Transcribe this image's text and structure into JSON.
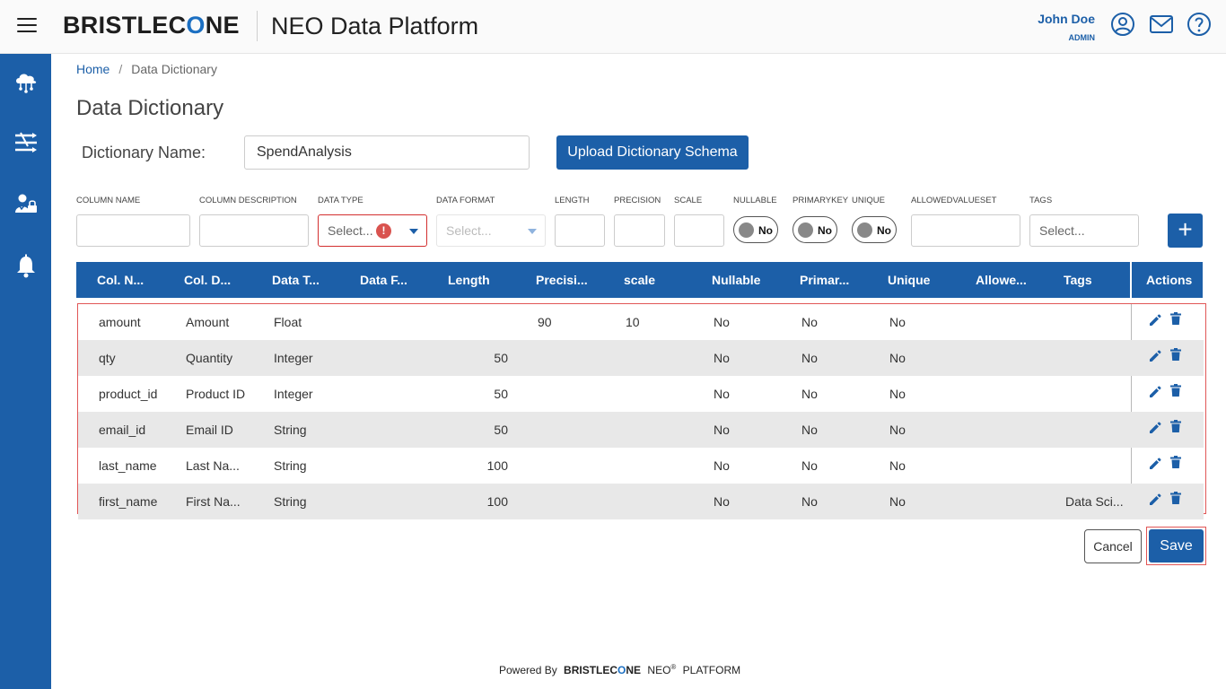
{
  "header": {
    "brand_left": "BRISTLEC",
    "brand_o": "O",
    "brand_right": "NE",
    "app_title": "NEO Data Platform",
    "user_name": "John Doe",
    "user_role": "ADMIN"
  },
  "breadcrumb": {
    "home": "Home",
    "sep": "/",
    "current": "Data Dictionary"
  },
  "page_title": "Data Dictionary",
  "dictionary": {
    "label": "Dictionary Name:",
    "value": "SpendAnalysis",
    "upload_label": "Upload Dictionary Schema"
  },
  "form": {
    "labels": {
      "column_name": "COLUMN NAME",
      "column_description": "COLUMN DESCRIPTION",
      "data_type": "DATA TYPE",
      "data_format": "DATA FORMAT",
      "length": "LENGTH",
      "precision": "PRECISION",
      "scale": "SCALE",
      "nullable": "NULLABLE",
      "primarykey": "PRIMARYKEY",
      "unique": "UNIQUE",
      "allowedvalueset": "ALLOWEDVALUESET",
      "tags": "TAGS"
    },
    "data_type_placeholder": "Select...",
    "data_type_error": "!",
    "data_format_placeholder": "Select...",
    "tags_placeholder": "Select...",
    "nullable_value": "No",
    "primarykey_value": "No",
    "unique_value": "No",
    "add_label": "+"
  },
  "table": {
    "headers": [
      "Col. N...",
      "Col. D...",
      "Data T...",
      "Data F...",
      "Length",
      "Precisi...",
      "scale",
      "Nullable",
      "Primar...",
      "Unique",
      "Allowe...",
      "Tags",
      "Actions"
    ],
    "rows": [
      {
        "name": "amount",
        "desc": "Amount",
        "type": "Float",
        "format": "",
        "length": "",
        "precision": "90",
        "scale": "10",
        "nullable": "No",
        "primary": "No",
        "unique": "No",
        "allowed": "",
        "tags": ""
      },
      {
        "name": "qty",
        "desc": "Quantity",
        "type": "Integer",
        "format": "",
        "length": "50",
        "precision": "",
        "scale": "",
        "nullable": "No",
        "primary": "No",
        "unique": "No",
        "allowed": "",
        "tags": ""
      },
      {
        "name": "product_id",
        "desc": "Product ID",
        "type": "Integer",
        "format": "",
        "length": "50",
        "precision": "",
        "scale": "",
        "nullable": "No",
        "primary": "No",
        "unique": "No",
        "allowed": "",
        "tags": ""
      },
      {
        "name": "email_id",
        "desc": "Email ID",
        "type": "String",
        "format": "",
        "length": "50",
        "precision": "",
        "scale": "",
        "nullable": "No",
        "primary": "No",
        "unique": "No",
        "allowed": "",
        "tags": ""
      },
      {
        "name": "last_name",
        "desc": "Last Na...",
        "type": "String",
        "format": "",
        "length": "100",
        "precision": "",
        "scale": "",
        "nullable": "No",
        "primary": "No",
        "unique": "No",
        "allowed": "",
        "tags": ""
      },
      {
        "name": "first_name",
        "desc": "First Na...",
        "type": "String",
        "format": "",
        "length": "100",
        "precision": "",
        "scale": "",
        "nullable": "No",
        "primary": "No",
        "unique": "No",
        "allowed": "",
        "tags": "Data Sci..."
      }
    ]
  },
  "buttons": {
    "cancel": "Cancel",
    "save": "Save"
  },
  "footer": {
    "powered_by": "Powered By",
    "brand_left": "BRISTLEC",
    "brand_o": "O",
    "brand_right": "NE",
    "neo": "NEO",
    "reg": "®",
    "platform": "PLATFORM"
  },
  "colors": {
    "primary": "#1c5fa8",
    "error": "#d9534f",
    "row_alt": "#e8e8e8"
  },
  "icons": [
    "menu-icon",
    "user-circle-icon",
    "mail-icon",
    "help-icon",
    "cloud-network-icon",
    "pipeline-icon",
    "user-admin-icon",
    "bell-icon",
    "edit-icon",
    "trash-icon"
  ]
}
